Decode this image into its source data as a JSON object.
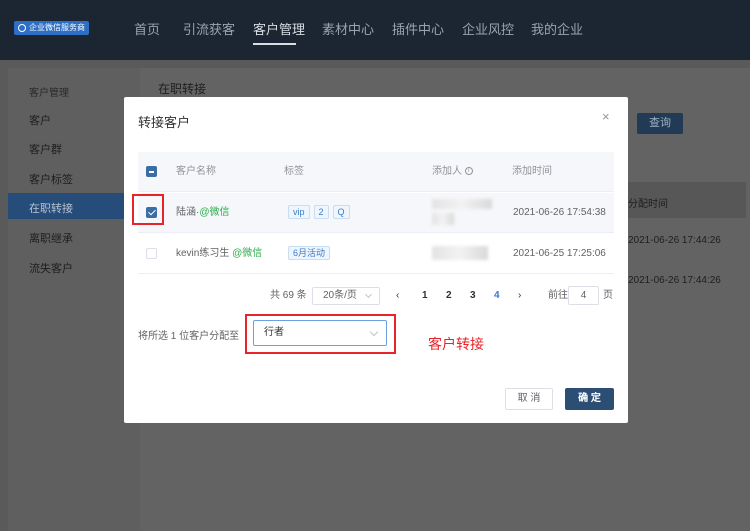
{
  "brand": {
    "logo_text": "企业微信服务商"
  },
  "topnav": {
    "items": [
      "首页",
      "引流获客",
      "客户管理",
      "素材中心",
      "插件中心",
      "企业风控",
      "我的企业"
    ],
    "active": "客户管理"
  },
  "sidebar": {
    "title": "客户管理",
    "items": [
      "客户",
      "客户群",
      "客户标签",
      "在职转接",
      "离职继承",
      "流失客户"
    ],
    "active": "在职转接"
  },
  "main": {
    "title": "在职转接",
    "query_button": "查询",
    "bg_header": "分配时间",
    "bg_times": [
      "2021-06-26 17:44:26",
      "2021-06-26 17:44:26"
    ]
  },
  "modal": {
    "title": "转接客户",
    "close_glyph": "×",
    "columns": {
      "name": "客户名称",
      "tags": "标签",
      "adder": "添加人",
      "added_time": "添加时间"
    },
    "rows": [
      {
        "name": "陆涵·",
        "platform": "@微信",
        "tags": [
          "vip",
          "2",
          "Q"
        ],
        "added_time": "2021-06-26 17:54:38",
        "checked": true
      },
      {
        "name": "kevin练习生",
        "platform": "@微信",
        "tags": [
          "6月活动"
        ],
        "added_time": "2021-06-25 17:25:06",
        "checked": false
      }
    ],
    "pagination": {
      "total": "共 69 条",
      "page_size": "20条/页",
      "pages": [
        "1",
        "2",
        "3",
        "4"
      ],
      "current": "4",
      "goto_prefix": "前往",
      "goto_value": "4",
      "goto_suffix": "页"
    },
    "assign": {
      "label": "将所选 1 位客户分配至",
      "value": "行者"
    },
    "annotation": "客户转接",
    "cancel": "取 消",
    "confirm": "确 定"
  }
}
